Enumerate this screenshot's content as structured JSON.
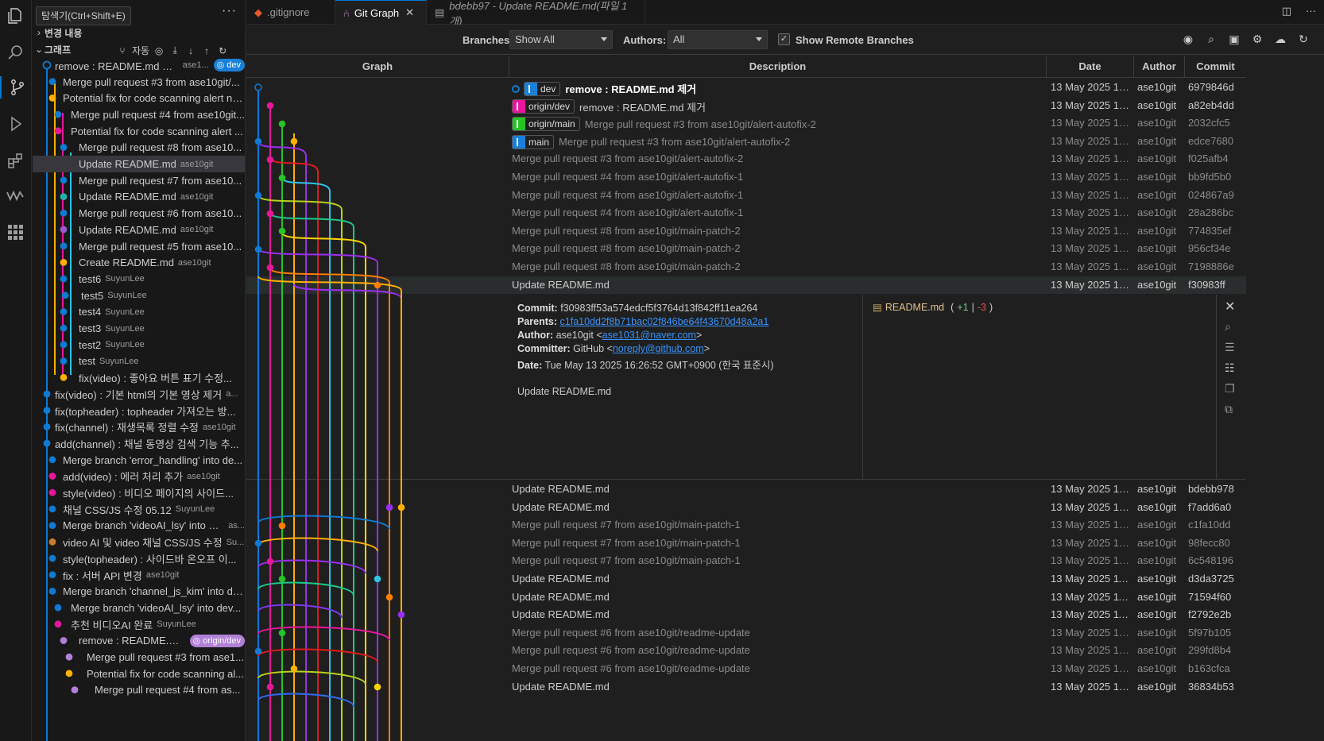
{
  "tooltip": "탐색기(Ctrl+Shift+E)",
  "sidebar": {
    "sections": {
      "changes": "변경 내용",
      "graph": "그래프",
      "auto": "자동"
    },
    "commits": [
      {
        "text": "remove : README.md 제거",
        "author": "ase1...",
        "badge": "dev",
        "color": "#0e7ad3",
        "badge_color": "#1a7fd8"
      },
      {
        "text": "Merge pull request #3 from ase10git/...",
        "author": "",
        "color": "#0e7ad3"
      },
      {
        "text": "Potential fix for code scanning alert no...",
        "author": "",
        "color": "#ffb000"
      },
      {
        "text": "Merge pull request #4 from ase10git...",
        "author": "",
        "color": "#0e7ad3"
      },
      {
        "text": "Potential fix for code scanning alert ...",
        "author": "",
        "color": "#e7179b"
      },
      {
        "text": "Merge pull request #8 from ase10...",
        "author": "",
        "color": "#0e7ad3"
      },
      {
        "text": "Update README.md",
        "author": "ase10git",
        "color": "#c97c2c"
      },
      {
        "text": "Merge pull request #7 from ase10...",
        "author": "",
        "color": "#0e7ad3"
      },
      {
        "text": "Update README.md",
        "author": "ase10git",
        "color": "#20b2aa"
      },
      {
        "text": "Merge pull request #6 from ase10...",
        "author": "",
        "color": "#0e7ad3"
      },
      {
        "text": "Update README.md",
        "author": "ase10git",
        "color": "#9b59d0"
      },
      {
        "text": "Merge pull request #5 from ase10...",
        "author": "",
        "color": "#0e7ad3"
      },
      {
        "text": "Create README.md",
        "author": "ase10git",
        "color": "#ffb000"
      },
      {
        "text": "test6",
        "author": "SuyunLee",
        "color": "#0e7ad3"
      },
      {
        "text": "test5",
        "author": "SuyunLee",
        "color": "#0e7ad3"
      },
      {
        "text": "test4",
        "author": "SuyunLee",
        "color": "#0e7ad3"
      },
      {
        "text": "test3",
        "author": "SuyunLee",
        "color": "#0e7ad3"
      },
      {
        "text": "test2",
        "author": "SuyunLee",
        "color": "#0e7ad3"
      },
      {
        "text": "test",
        "author": "SuyunLee",
        "color": "#0e7ad3"
      },
      {
        "text": "fix(video) : 좋아요 버튼 표기 수정...",
        "author": "",
        "color": "#ffb000"
      },
      {
        "text": "fix(video) : 기본 html의 기본 영상 제거",
        "author": "a...",
        "color": "#0e7ad3"
      },
      {
        "text": "fix(topheader) : topheader 가져오는 방...",
        "author": "",
        "color": "#0e7ad3"
      },
      {
        "text": "fix(channel) : 재생목록 정렬 수정",
        "author": "ase10git",
        "color": "#0e7ad3"
      },
      {
        "text": "add(channel) : 채널 동영상 검색 기능 추...",
        "author": "",
        "color": "#0e7ad3"
      },
      {
        "text": "Merge branch 'error_handling' into de...",
        "author": "",
        "color": "#0e7ad3"
      },
      {
        "text": "add(video) : 에러 처리 추가",
        "author": "ase10git",
        "color": "#e7179b"
      },
      {
        "text": "style(video) : 비디오 페이지의 사이드...",
        "author": "",
        "color": "#e7179b"
      },
      {
        "text": "채널 CSS/JS 수정 05.12",
        "author": "SuyunLee",
        "color": "#0e7ad3"
      },
      {
        "text": "Merge branch 'videoAI_lsy' into dev",
        "author": "as...",
        "color": "#0e7ad3"
      },
      {
        "text": "video AI 및 video 채널 CSS/JS 수정",
        "author": "Su...",
        "color": "#c97c2c"
      },
      {
        "text": "style(topheader) : 사이드바 온오프 이...",
        "author": "",
        "color": "#0e7ad3"
      },
      {
        "text": "fix : 서버 API 변경",
        "author": "ase10git",
        "color": "#0e7ad3"
      },
      {
        "text": "Merge branch 'channel_js_kim' into de...",
        "author": "",
        "color": "#0e7ad3"
      },
      {
        "text": "Merge branch 'videoAI_lsy' into dev...",
        "author": "",
        "color": "#0e7ad3"
      },
      {
        "text": "추천 비디오AI 완료",
        "author": "SuyunLee",
        "color": "#e7179b"
      },
      {
        "text": "remove : README.m...",
        "author": "",
        "badge": "origin/dev",
        "color": "#b180d7",
        "badge_color": "#b180d7"
      },
      {
        "text": "Merge pull request #3 from ase1...",
        "author": "",
        "color": "#b180d7"
      },
      {
        "text": "Potential fix for code scanning al...",
        "author": "",
        "color": "#ffb000"
      },
      {
        "text": "Merge pull request #4 from as...",
        "author": "",
        "color": "#b180d7"
      }
    ]
  },
  "tabs": [
    {
      "label": ".gitignore",
      "icon": "git-icon"
    },
    {
      "label": "Git Graph",
      "icon": "git-graph-icon"
    },
    {
      "label": "bdebb97 - Update README.md(파일 1개)",
      "icon": "diff-icon"
    }
  ],
  "toolbar": {
    "branches_label": "Branches:",
    "branches_value": "Show All",
    "authors_label": "Authors:",
    "authors_value": "All",
    "remote_label": "Show Remote Branches",
    "remote_checked": true
  },
  "columns": {
    "graph": "Graph",
    "description": "Description",
    "date": "Date",
    "author": "Author",
    "commit": "Commit"
  },
  "rows_top": [
    {
      "refs": [
        {
          "name": "dev",
          "color": "#1a7fd8"
        }
      ],
      "msg": "remove : README.md 제거",
      "date": "13 May 2025 16:...",
      "author": "ase10git",
      "hash": "6979846d",
      "dim": false,
      "head": true
    },
    {
      "refs": [
        {
          "name": "origin/dev",
          "color": "#e7179b"
        }
      ],
      "msg": "remove : README.md 제거",
      "date": "13 May 2025 16:...",
      "author": "ase10git",
      "hash": "a82eb4dd",
      "dim": false
    },
    {
      "refs": [
        {
          "name": "origin/main",
          "color": "#26c426"
        }
      ],
      "msg": "Merge pull request #3 from ase10git/alert-autofix-2",
      "date": "13 May 2025 16:...",
      "author": "ase10git",
      "hash": "2032cfc5",
      "dim": true
    },
    {
      "refs": [
        {
          "name": "main",
          "color": "#1a7fd8"
        }
      ],
      "msg": "Merge pull request #3 from ase10git/alert-autofix-2",
      "date": "13 May 2025 16:...",
      "author": "ase10git",
      "hash": "edce7680",
      "dim": true
    },
    {
      "refs": [],
      "msg": "Merge pull request #3 from ase10git/alert-autofix-2",
      "date": "13 May 2025 16:...",
      "author": "ase10git",
      "hash": "f025afb4",
      "dim": true
    },
    {
      "refs": [],
      "msg": "Merge pull request #4 from ase10git/alert-autofix-1",
      "date": "13 May 2025 16:...",
      "author": "ase10git",
      "hash": "bb9fd5b0",
      "dim": true
    },
    {
      "refs": [],
      "msg": "Merge pull request #4 from ase10git/alert-autofix-1",
      "date": "13 May 2025 16:...",
      "author": "ase10git",
      "hash": "024867a9",
      "dim": true
    },
    {
      "refs": [],
      "msg": "Merge pull request #4 from ase10git/alert-autofix-1",
      "date": "13 May 2025 16:...",
      "author": "ase10git",
      "hash": "28a286bc",
      "dim": true
    },
    {
      "refs": [],
      "msg": "Merge pull request #8 from ase10git/main-patch-2",
      "date": "13 May 2025 16:...",
      "author": "ase10git",
      "hash": "774835ef",
      "dim": true
    },
    {
      "refs": [],
      "msg": "Merge pull request #8 from ase10git/main-patch-2",
      "date": "13 May 2025 16:...",
      "author": "ase10git",
      "hash": "956cf34e",
      "dim": true
    },
    {
      "refs": [],
      "msg": "Merge pull request #8 from ase10git/main-patch-2",
      "date": "13 May 2025 16:...",
      "author": "ase10git",
      "hash": "7198886e",
      "dim": true
    },
    {
      "refs": [],
      "msg": "Update README.md",
      "date": "13 May 2025 16:...",
      "author": "ase10git",
      "hash": "f30983ff",
      "dim": false,
      "sel": true
    }
  ],
  "detail": {
    "commit_label": "Commit:",
    "commit": "f30983ff53a574edcf5f3764d13f842ff11ea264",
    "parents_label": "Parents:",
    "parents": "c1fa10dd2f8b71bac02f846be64f43670d48a2a1",
    "author_label": "Author:",
    "author_name": "ase10git <",
    "author_email": "ase1031@naver.com",
    "author_end": ">",
    "committer_label": "Committer:",
    "committer_name": "GitHub <",
    "committer_email": "noreply@github.com",
    "committer_end": ">",
    "date_label": "Date:",
    "date": "Tue May 13 2025 16:26:52 GMT+0900 (한국 표준시)",
    "message": "Update README.md",
    "file": "README.md",
    "file_add": "+1",
    "file_sep": "|",
    "file_del": "-3",
    "file_open": "(",
    "file_close": ")"
  },
  "rows_bottom": [
    {
      "msg": "Update README.md",
      "date": "13 May 2025 16:...",
      "author": "ase10git",
      "hash": "bdebb978",
      "dim": false
    },
    {
      "msg": "Update README.md",
      "date": "13 May 2025 16:...",
      "author": "ase10git",
      "hash": "f7add6a0",
      "dim": false
    },
    {
      "msg": "Merge pull request #7 from ase10git/main-patch-1",
      "date": "13 May 2025 12:...",
      "author": "ase10git",
      "hash": "c1fa10dd",
      "dim": true
    },
    {
      "msg": "Merge pull request #7 from ase10git/main-patch-1",
      "date": "13 May 2025 12:...",
      "author": "ase10git",
      "hash": "98fecc80",
      "dim": true
    },
    {
      "msg": "Merge pull request #7 from ase10git/main-patch-1",
      "date": "13 May 2025 12:...",
      "author": "ase10git",
      "hash": "6c548196",
      "dim": true
    },
    {
      "msg": "Update README.md",
      "date": "13 May 2025 11:...",
      "author": "ase10git",
      "hash": "d3da3725",
      "dim": false
    },
    {
      "msg": "Update README.md",
      "date": "13 May 2025 11:...",
      "author": "ase10git",
      "hash": "71594f60",
      "dim": false
    },
    {
      "msg": "Update README.md",
      "date": "13 May 2025 11:...",
      "author": "ase10git",
      "hash": "f2792e2b",
      "dim": false
    },
    {
      "msg": "Merge pull request #6 from ase10git/readme-update",
      "date": "13 May 2025 10:...",
      "author": "ase10git",
      "hash": "5f97b105",
      "dim": true
    },
    {
      "msg": "Merge pull request #6 from ase10git/readme-update",
      "date": "13 May 2025 10:...",
      "author": "ase10git",
      "hash": "299fd8b4",
      "dim": true
    },
    {
      "msg": "Merge pull request #6 from ase10git/readme-update",
      "date": "13 May 2025 10:...",
      "author": "ase10git",
      "hash": "b163cfca",
      "dim": true
    },
    {
      "msg": "Update README.md",
      "date": "13 May 2025 10:...",
      "author": "ase10git",
      "hash": "36834b53",
      "dim": false
    }
  ],
  "graph_colors": [
    "#0e7ad3",
    "#e7179b",
    "#26c426",
    "#ffb000",
    "#e21a1a",
    "#2ec5e6",
    "#9b2ff0",
    "#b9d21b",
    "#ff7e00",
    "#1ac98a",
    "#2f6cf0",
    "#ffd500",
    "#7c3aed",
    "#ffcc00"
  ]
}
